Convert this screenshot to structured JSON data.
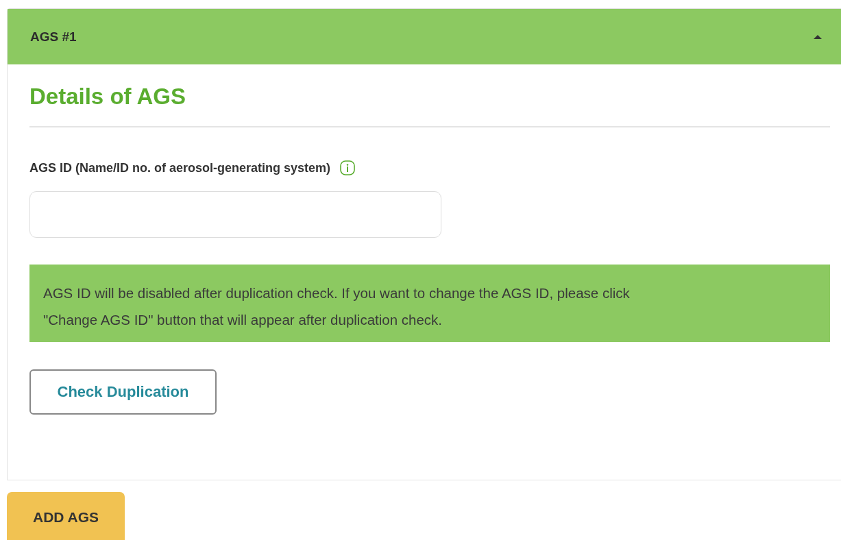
{
  "panel": {
    "title": "AGS #1",
    "expanded": true
  },
  "section": {
    "heading": "Details of AGS"
  },
  "field": {
    "label": "AGS ID (Name/ID no. of aerosol-generating system)"
  },
  "notice": {
    "lines": [
      "AGS ID will be disabled after duplication check. If you want to change the AGS ID, please click",
      "\"Change AGS ID\" button that will appear after duplication check."
    ]
  },
  "check_button": {
    "label": "Check Duplication"
  },
  "add_button": {
    "label": "ADD AGS"
  }
}
